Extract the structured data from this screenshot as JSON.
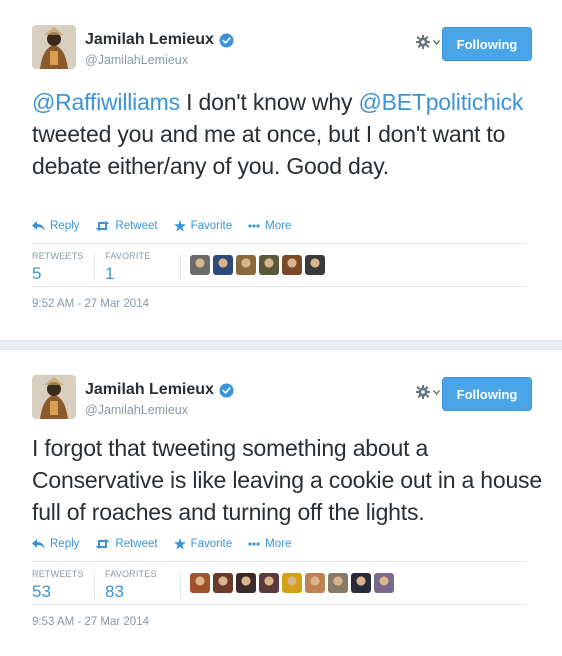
{
  "tweets": [
    {
      "author": {
        "name": "Jamilah Lemieux",
        "handle": "@JamilahLemieux"
      },
      "follow_label": "Following",
      "text": {
        "mention1": "@Raffiwilliams",
        "part1": " I don't know why ",
        "mention2": "@BETpolitichick",
        "part2": " tweeted you and me at once, but I don't want to debate either/any of you. Good day."
      },
      "actions": {
        "reply": "Reply",
        "retweet": "Retweet",
        "favorite": "Favorite",
        "more": "More"
      },
      "stats": {
        "retweets_label": "RETWEETS",
        "retweets": "5",
        "favorites_label": "FAVORITE",
        "favorites": "1"
      },
      "faces": [
        "#6b6b6b",
        "#2d4a7a",
        "#8a6a3a",
        "#5a5a3a",
        "#7a4a2a",
        "#3a3a3a"
      ],
      "timestamp": "9:52 AM - 27 Mar 2014"
    },
    {
      "author": {
        "name": "Jamilah Lemieux",
        "handle": "@JamilahLemieux"
      },
      "follow_label": "Following",
      "text": {
        "body": "I forgot that tweeting something about a Conservative is like leaving a cookie out in a house full of roaches and turning off the lights."
      },
      "actions": {
        "reply": "Reply",
        "retweet": "Retweet",
        "favorite": "Favorite",
        "more": "More"
      },
      "stats": {
        "retweets_label": "RETWEETS",
        "retweets": "53",
        "favorites_label": "FAVORITES",
        "favorites": "83"
      },
      "faces": [
        "#a0522d",
        "#6b3a2a",
        "#3a2a2a",
        "#5a3a3a",
        "#d4a017",
        "#c08050",
        "#8a7a6a",
        "#2a2a3a",
        "#7a6a8a"
      ],
      "timestamp": "9:53 AM - 27 Mar 2014"
    }
  ],
  "colors": {
    "accent": "#3b94d9",
    "follow_bg": "#4aa5e8",
    "muted": "#8899a6"
  },
  "icons": [
    "verified-badge-icon",
    "gear-icon",
    "chevron-down-icon",
    "reply-icon",
    "retweet-icon",
    "star-icon",
    "more-icon"
  ]
}
